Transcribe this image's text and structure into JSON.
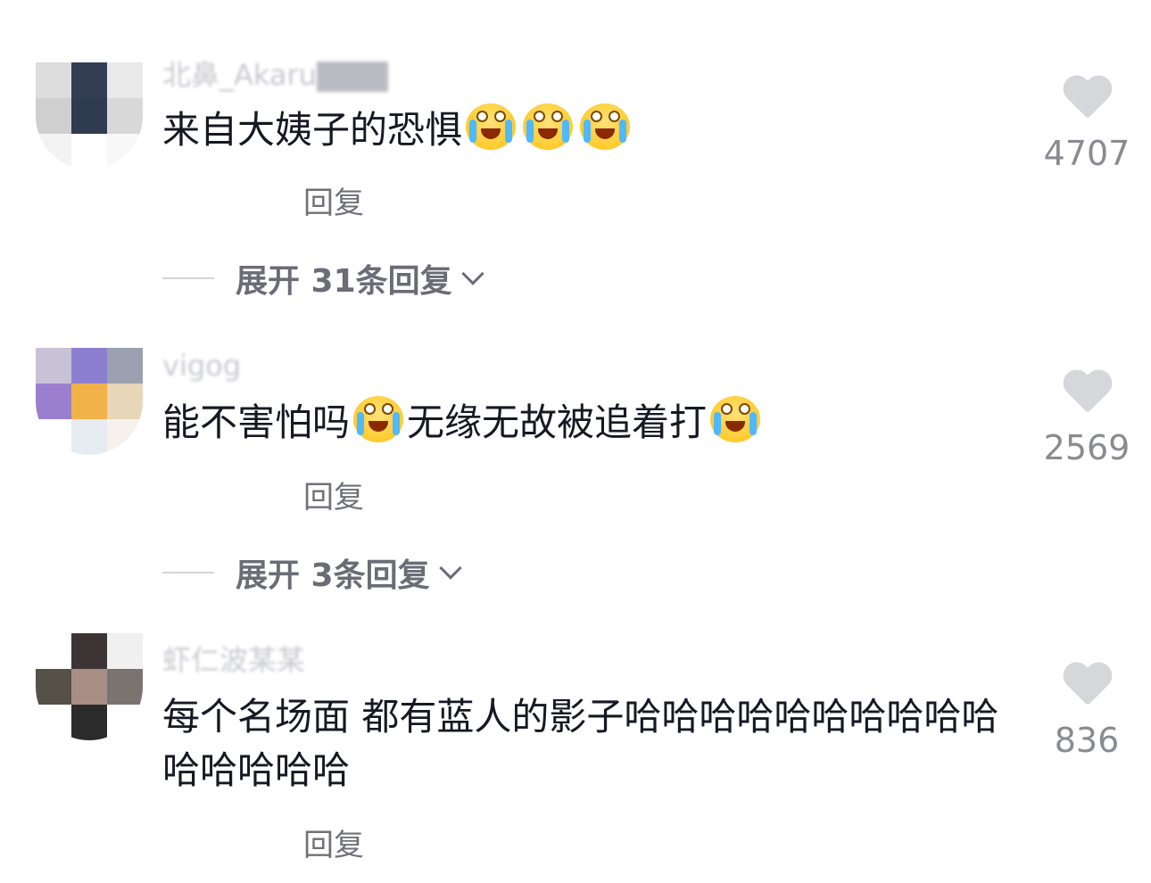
{
  "comments": [
    {
      "username": "北鼻_Akaru",
      "content_text": "来自大姨子的恐惧",
      "emojis": [
        "cry-laugh-emoji",
        "cry-laugh-emoji",
        "cry-laugh-emoji"
      ],
      "reply_label": "回复",
      "expand_label": "展开 31条回复",
      "likes": "4707"
    },
    {
      "username": "vigog",
      "content_part1": "能不害怕吗",
      "content_part2": "无缘无故被追着打",
      "emojis": [
        "cry-laugh-emoji",
        "cry-laugh-emoji"
      ],
      "reply_label": "回复",
      "expand_label": "展开 3条回复",
      "likes": "2569"
    },
    {
      "username": "虾仁波某某",
      "content_text": "每个名场面 都有蓝人的影子哈哈哈哈哈哈哈哈哈哈哈哈哈哈哈",
      "reply_label": "回复",
      "likes": "836"
    }
  ],
  "colors": {
    "text": "#161823",
    "muted": "#9a9ba2",
    "heart": "#d6d7db",
    "emoji": "#ffcb2e",
    "tear": "#4fb8ff"
  }
}
